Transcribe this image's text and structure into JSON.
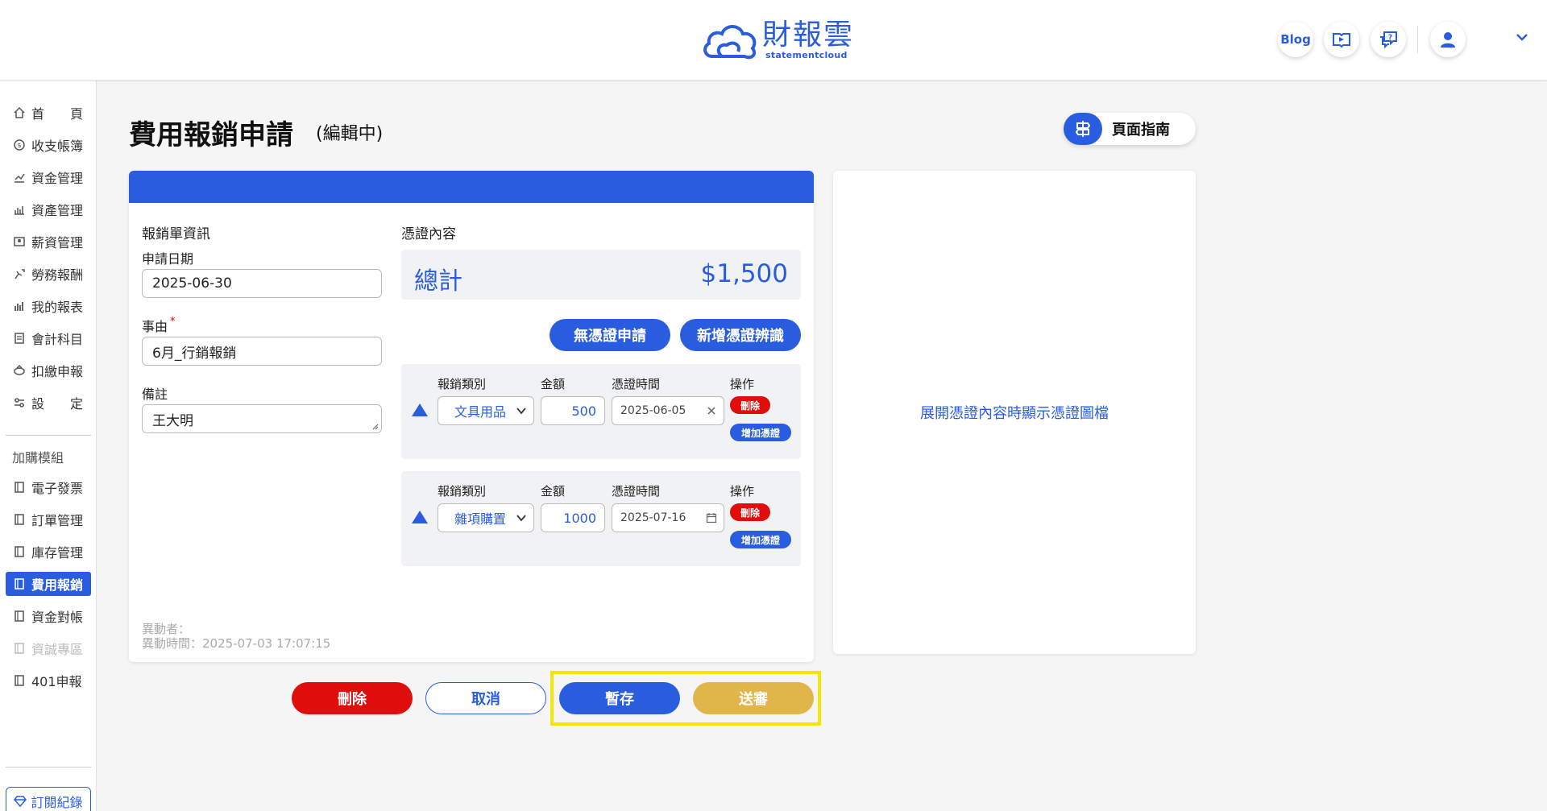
{
  "header": {
    "logo_cn": "財報雲",
    "logo_en": "statementcloud",
    "blog_label": "Blog"
  },
  "sidebar": {
    "items": [
      {
        "label": "首　　頁",
        "icon": "home-icon"
      },
      {
        "label": "收支帳簿",
        "icon": "coin-icon"
      },
      {
        "label": "資金管理",
        "icon": "funds-icon"
      },
      {
        "label": "資產管理",
        "icon": "assets-icon"
      },
      {
        "label": "薪資管理",
        "icon": "salary-icon"
      },
      {
        "label": "勞務報酬",
        "icon": "labor-icon"
      },
      {
        "label": "我的報表",
        "icon": "report-icon"
      },
      {
        "label": "會計科目",
        "icon": "ledger-icon"
      },
      {
        "label": "扣繳申報",
        "icon": "withholding-icon"
      },
      {
        "label": "設　　定",
        "icon": "settings-icon"
      }
    ],
    "addon_heading": "加購模組",
    "addons": [
      {
        "label": "電子發票",
        "state": "normal"
      },
      {
        "label": "訂單管理",
        "state": "normal"
      },
      {
        "label": "庫存管理",
        "state": "normal"
      },
      {
        "label": "費用報銷",
        "state": "active"
      },
      {
        "label": "資金對帳",
        "state": "normal"
      },
      {
        "label": "資誠專區",
        "state": "disabled"
      },
      {
        "label": "401申報",
        "state": "normal"
      }
    ],
    "subscription_label": "訂閱紀錄"
  },
  "page": {
    "title": "費用報銷申請",
    "subtitle": "(編輯中)",
    "guide_label": "頁面指南"
  },
  "form": {
    "section_title": "報銷單資訊",
    "date_label": "申請日期",
    "date_value": "2025-06-30",
    "reason_label": "事由",
    "reason_required": "*",
    "reason_value": "6月_行銷報銷",
    "note_label": "備註",
    "note_value": "王大明",
    "modifier_label": "異動者：",
    "modified_time": "異動時間：2025-07-03 17:07:15"
  },
  "voucher": {
    "section_title": "憑證內容",
    "total_label": "總計",
    "total_value": "$1,500",
    "no_voucher_button": "無憑證申請",
    "add_recognition_button": "新增憑證辨識",
    "col_category": "報銷類別",
    "col_amount": "金額",
    "col_time": "憑證時間",
    "col_action": "操作",
    "delete_label": "刪除",
    "add_voucher_label": "增加憑證",
    "rows": [
      {
        "category": "文具用品",
        "amount": "500",
        "date": "2025-06-05"
      },
      {
        "category": "雜項購置",
        "amount": "1000",
        "date": "2025-07-16"
      }
    ]
  },
  "preview": {
    "text": "展開憑證內容時顯示憑證圖檔"
  },
  "actions": {
    "delete": "刪除",
    "cancel": "取消",
    "save_draft": "暫存",
    "submit": "送審"
  },
  "colors": {
    "primary": "#2a5ce0",
    "danger": "#e00d0d",
    "submit": "#e0b54a",
    "highlight": "#f7e400"
  }
}
